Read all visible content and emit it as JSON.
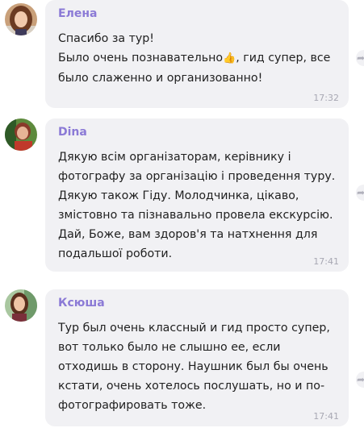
{
  "messages": [
    {
      "author": "Елена",
      "lines": [
        "Спасибо за тур!",
        "Было очень познавательно",
        ", гид супер, все",
        "было слаженно и организованно!"
      ],
      "emoji": "👍",
      "time": "17:32"
    },
    {
      "author": "Dina",
      "text": "Дякую всім організаторам, керівнику і\nфотографу за організацію і проведення туру.\nДякую також Гіду. Молодчинка, цікаво,\nзмістовно та пізнавально провела екскурсію.\nДай, Боже, вам здоров'я та натхнення для\nподальшої роботи.",
      "time": "17:41"
    },
    {
      "author": "Ксюша",
      "text": "Тур был очень классный и гид просто супер,\nвот только было не слышно ее, если\nотходишь в сторону. Наушник был бы очень\nкстати, очень хотелось послушать, но и по-\nфотографировать тоже.",
      "time": "17:41"
    }
  ],
  "icons": {
    "avatar": "user-avatar-photo",
    "share": "share-icon"
  },
  "colors": {
    "author": "#8b7ad6",
    "bubble": "#f1f1f4",
    "time": "#a8a8b3"
  }
}
